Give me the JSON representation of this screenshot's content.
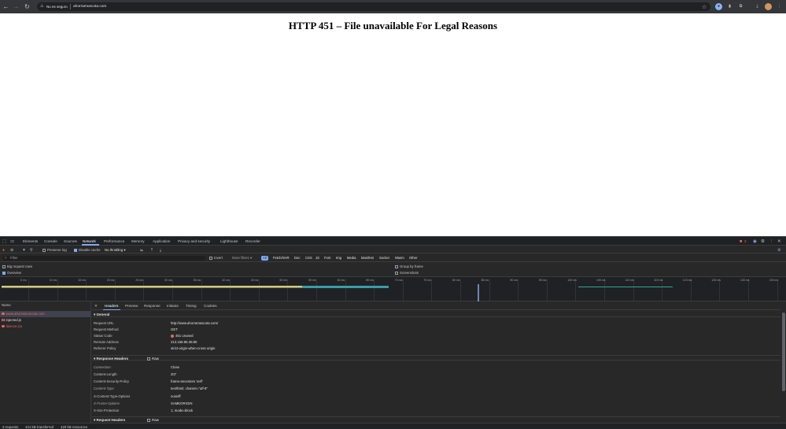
{
  "browser": {
    "security_label": "No es seguro",
    "url": "ahorramuscota.com"
  },
  "page": {
    "title": "HTTP 451 – File unavailable For Legal Reasons"
  },
  "devtools": {
    "tabs": [
      "Elements",
      "Console",
      "Sources",
      "Network",
      "Performance",
      "Memory",
      "Application",
      "Privacy and security",
      "Lighthouse",
      "Recorder"
    ],
    "issues_count": "2",
    "toolbar": {
      "preserve_log": "Preserve log",
      "disable_cache": "Disable cache",
      "throttling": "No throttling"
    },
    "filter": {
      "placeholder": "Filter",
      "invert": "Invert",
      "more_filters": "More filters",
      "chips": [
        "All",
        "Fetch/XHR",
        "Doc",
        "CSS",
        "JS",
        "Font",
        "Img",
        "Media",
        "Manifest",
        "Socket",
        "Wasm",
        "Other"
      ]
    },
    "settings": {
      "big_rows": "Big request rows",
      "overview": "Overview",
      "group_by_frame": "Group by frame",
      "screenshots": "Screenshots"
    },
    "timeline_ticks": [
      "5 ms",
      "10 ms",
      "15 ms",
      "20 ms",
      "25 ms",
      "30 ms",
      "35 ms",
      "40 ms",
      "45 ms",
      "50 ms",
      "55 ms",
      "60 ms",
      "65 ms",
      "70 ms",
      "75 ms",
      "80 ms",
      "85 ms",
      "90 ms",
      "95 ms",
      "100 ms",
      "105 ms",
      "110 ms",
      "115 ms",
      "120 ms",
      "125 ms",
      "130 ms",
      "135 ms"
    ],
    "request_list": {
      "header": "Name",
      "rows": [
        "www.ahorramuscota.com",
        "injected.js",
        "favicon.ico"
      ]
    },
    "detail_tabs": [
      "Headers",
      "Preview",
      "Response",
      "Initiator",
      "Timing",
      "Cookies"
    ],
    "general": {
      "title": "General",
      "rows": [
        {
          "k": "Request URL",
          "v": "http://www.ahorramascota.com/"
        },
        {
          "k": "Request Method",
          "v": "GET"
        },
        {
          "k": "Status Code",
          "v": "451 unused"
        },
        {
          "k": "Remote Address",
          "v": "213.158.86.35:80"
        },
        {
          "k": "Referrer Policy",
          "v": "strict-origin-when-cross-origin"
        }
      ]
    },
    "response_headers": {
      "title": "Response Headers",
      "raw": "Raw",
      "rows": [
        {
          "k": "Connection",
          "v": "Close"
        },
        {
          "k": "Content-Length",
          "v": "207"
        },
        {
          "k": "Content-Security-Policy",
          "v": "frame-ancestors 'self'"
        },
        {
          "k": "Content-Type",
          "v": "text/html; charset=\"utf-8\""
        },
        {
          "k": "X-Content-Type-Options",
          "v": "nosniff"
        },
        {
          "k": "X-Frame-Options",
          "v": "SAMEORIGIN"
        },
        {
          "k": "X-Xss-Protection",
          "v": "1; mode=block"
        }
      ]
    },
    "request_headers": {
      "title": "Request Headers",
      "raw": "Raw"
    },
    "status_bar": {
      "requests": "3 requests",
      "transferred": "421 kB transferred",
      "resources": "420 kB resources"
    }
  }
}
